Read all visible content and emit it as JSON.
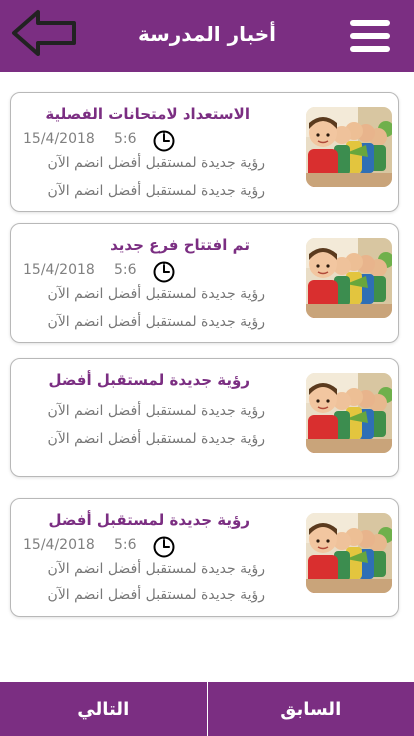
{
  "header": {
    "title": "أخبار المدرسة",
    "menu_icon": "hamburger-menu-icon",
    "back_icon": "back-arrow-icon"
  },
  "colors": {
    "primary": "#7b2e82",
    "text_gray": "#777777",
    "white": "#ffffff"
  },
  "news": [
    {
      "title": "الاستعداد لامتحانات الفصلية",
      "time": "5:6",
      "date": "15/4/2018",
      "lines": [
        "رؤية جديدة لمستقبل أفضل انضم الآن",
        "رؤية جديدة لمستقبل أفضل انضم الآن"
      ]
    },
    {
      "title": "تم افتتاح فرع جديد",
      "time": "5:6",
      "date": "15/4/2018",
      "lines": [
        "رؤية جديدة لمستقبل أفضل انضم الآن",
        "رؤية جديدة لمستقبل أفضل انضم الآن"
      ]
    },
    {
      "title": "رؤية جديدة لمستقبل أفضل",
      "lines": [
        "رؤية جديدة لمستقبل أفضل انضم الآن",
        "رؤية جديدة لمستقبل أفضل انضم الآن"
      ]
    },
    {
      "title": "رؤية جديدة لمستقبل أفضل",
      "time": "5:6",
      "date": "15/4/2018",
      "lines": [
        "رؤية جديدة لمستقبل أفضل انضم الآن",
        "رؤية جديدة لمستقبل أفضل انضم الآن"
      ]
    }
  ],
  "footer": {
    "next_label": "التالي",
    "prev_label": "السابق"
  }
}
